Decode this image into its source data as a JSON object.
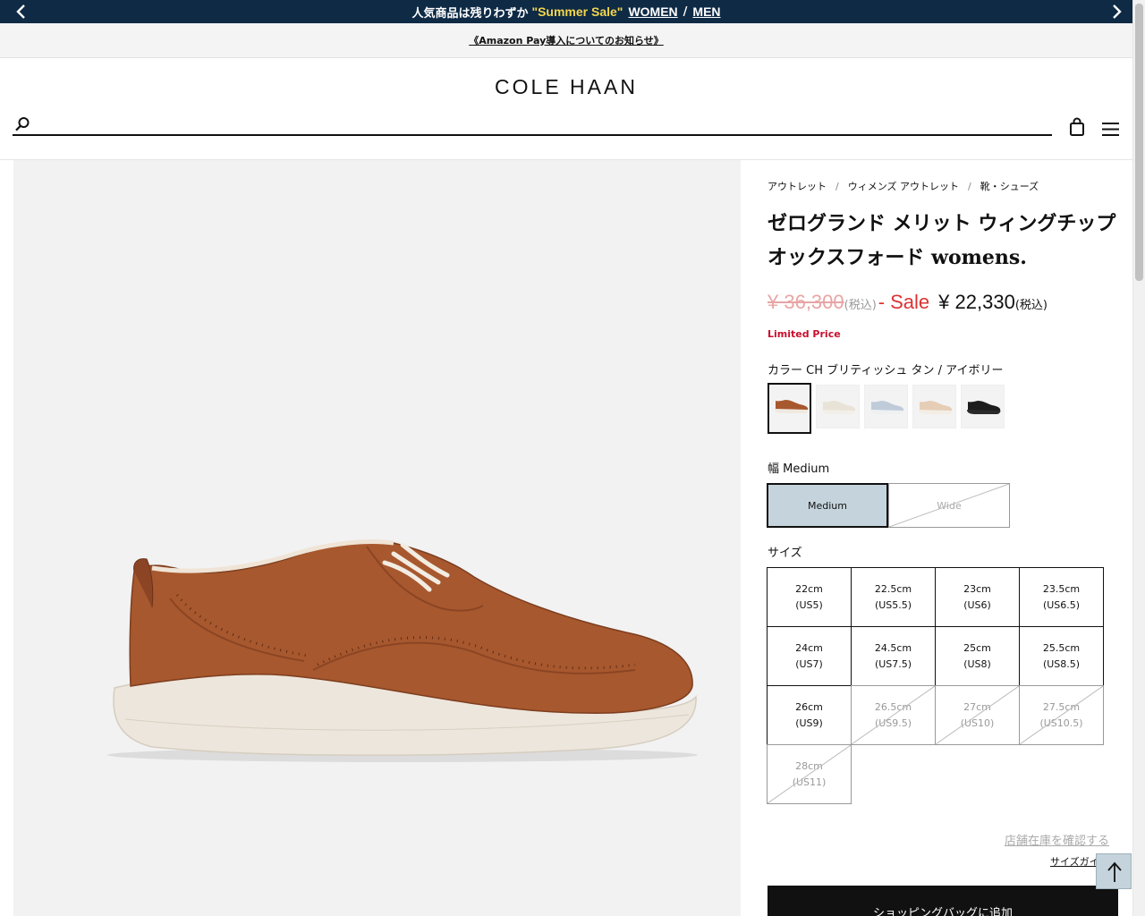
{
  "promo": {
    "text": "人気商品は残りわずか",
    "highlight": "\"Summer Sale\"",
    "link_women": "WOMEN",
    "separator": "/",
    "link_men": "MEN"
  },
  "notice": {
    "text": "《Amazon Pay導入についてのお知らせ》"
  },
  "header": {
    "logo": "COLE HAAN",
    "search_placeholder": ""
  },
  "breadcrumb": [
    "アウトレット",
    "ウィメンズ アウトレット",
    "靴・シューズ"
  ],
  "product": {
    "title": "ゼログランド メリット ウィングチップ オックスフォード womens.",
    "original_price": "¥ 36,300",
    "tax_label": "(税込)",
    "dash": "-",
    "sale_label": "Sale",
    "sale_price": "¥ 22,330",
    "limited": "Limited Price",
    "color_label": "カラー CH ブリティッシュ タン / アイボリー",
    "swatches": [
      {
        "name": "CH ブリティッシュ タン / アイボリー",
        "upper": "#a8582e",
        "sole": "#efe9e0",
        "selected": true
      },
      {
        "name": "ivory",
        "upper": "#e8e3d6",
        "sole": "#f2efe8",
        "selected": false
      },
      {
        "name": "light blue",
        "upper": "#bfcbd8",
        "sole": "#eef0f2",
        "selected": false
      },
      {
        "name": "nude",
        "upper": "#e6cdb5",
        "sole": "#f3ede5",
        "selected": false
      },
      {
        "name": "black",
        "upper": "#1c1c1c",
        "sole": "#2a2a2a",
        "selected": false
      }
    ],
    "width_label": "幅 Medium",
    "widths": [
      {
        "label": "Medium",
        "selected": true,
        "available": true
      },
      {
        "label": "Wide",
        "selected": false,
        "available": false
      }
    ],
    "size_label": "サイズ",
    "sizes": [
      {
        "cm": "22cm",
        "us": "(US5)",
        "available": true
      },
      {
        "cm": "22.5cm",
        "us": "(US5.5)",
        "available": true
      },
      {
        "cm": "23cm",
        "us": "(US6)",
        "available": true
      },
      {
        "cm": "23.5cm",
        "us": "(US6.5)",
        "available": true
      },
      {
        "cm": "24cm",
        "us": "(US7)",
        "available": true
      },
      {
        "cm": "24.5cm",
        "us": "(US7.5)",
        "available": true
      },
      {
        "cm": "25cm",
        "us": "(US8)",
        "available": true
      },
      {
        "cm": "25.5cm",
        "us": "(US8.5)",
        "available": true
      },
      {
        "cm": "26cm",
        "us": "(US9)",
        "available": true
      },
      {
        "cm": "26.5cm",
        "us": "(US9.5)",
        "available": false
      },
      {
        "cm": "27cm",
        "us": "(US10)",
        "available": false
      },
      {
        "cm": "27.5cm",
        "us": "(US10.5)",
        "available": false
      },
      {
        "cm": "28cm",
        "us": "(US11)",
        "available": false
      }
    ],
    "store_stock": "店舗在庫を確認する",
    "size_guide": "サイズガイ",
    "add_to_bag": "ショッピングバッグに追加"
  },
  "colors": {
    "promo_bg": "#0e2a45",
    "sale_red": "#d33333",
    "selected_bg": "#c5d4dc"
  },
  "icons": {
    "prev": "chevron-left-icon",
    "next": "chevron-right-icon",
    "search": "search-icon",
    "bag": "shopping-bag-icon",
    "menu": "hamburger-menu-icon",
    "top": "arrow-up-icon"
  }
}
